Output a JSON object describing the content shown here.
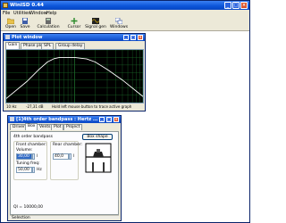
{
  "app": {
    "title": "WinISD 0.44",
    "menu": [
      "File",
      "Utilities",
      "Window",
      "Help"
    ],
    "toolbar": [
      {
        "label": "Open",
        "icon": "folder-open-icon"
      },
      {
        "label": "Save",
        "icon": "floppy-disk-icon"
      },
      {
        "label": "Calculation",
        "icon": "calculator-icon"
      },
      {
        "label": "Cursor",
        "icon": "plus-cursor-icon"
      },
      {
        "label": "Signal gen",
        "icon": "signal-generator-icon"
      },
      {
        "label": "Windows",
        "icon": "windows-icon"
      }
    ]
  },
  "plot": {
    "title": "Plot window",
    "tabs": [
      "Gain",
      "Phase plot",
      "SPL",
      "Group delay"
    ],
    "active_tab": "Gain",
    "status": {
      "left": "10 Hz",
      "mid": "-27,31 dB",
      "hint": "Hold left mouse button to trace active graph"
    },
    "chart_data": {
      "type": "line",
      "x": [
        10,
        20,
        30,
        40,
        50,
        60,
        80,
        100,
        150,
        200,
        300,
        500,
        1000
      ],
      "y": [
        -27.3,
        -16,
        -8,
        -3,
        -0.8,
        0,
        0,
        0,
        -1,
        -3,
        -8,
        -15,
        -26
      ],
      "ylim": [
        -30,
        5
      ],
      "grid": true,
      "series_color": "#ffffff",
      "grid_color": "#1c6a2a"
    }
  },
  "box": {
    "title": "[1]4th order bandpass : Hertz ...",
    "tabs": [
      "Driver",
      "Box",
      "Vents",
      "Plot",
      "Project"
    ],
    "active_tab": "Box",
    "type_label": "4th order bandpass",
    "front": {
      "label": "Front chamber:",
      "vol_label": "Volume:",
      "volume": "30,00",
      "tuning_label": "Tuning freq:",
      "tuning": "50,00",
      "unit": "Hz"
    },
    "rear": {
      "label": "Rear chamber:",
      "volume": "40,0",
      "unit": "l"
    },
    "shape_button": "Box shape",
    "qi": "QI = 10000,00",
    "bottom": "Selection"
  }
}
